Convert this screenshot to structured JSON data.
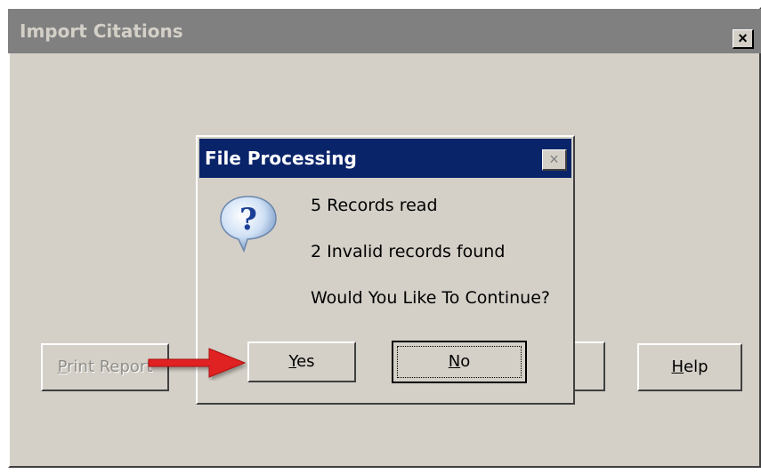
{
  "window": {
    "title": "Import Citations",
    "close_label": "×"
  },
  "buttons": {
    "print_report": {
      "accel": "P",
      "rest": "rint Report"
    },
    "help": {
      "accel": "H",
      "rest": "elp"
    }
  },
  "dialog": {
    "title": "File Processing",
    "close_label": "×",
    "messages": [
      "5 Records read",
      "2 Invalid records found",
      "Would You Like To Continue?"
    ],
    "yes": {
      "accel": "Y",
      "rest": "es"
    },
    "no": {
      "accel": "N",
      "rest": "o"
    }
  },
  "icons": {
    "question": "question-icon",
    "arrow": "red-arrow-icon"
  },
  "colors": {
    "active_title": "#0a246a",
    "inactive_title": "#808080",
    "face": "#d4d0c8",
    "arrow": "#e02020"
  }
}
